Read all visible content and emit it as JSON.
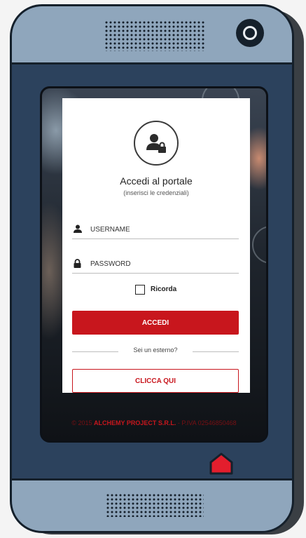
{
  "login": {
    "title": "Accedi al portale",
    "subtitle": "(inserisci le credenziali)",
    "username_placeholder": "USERNAME",
    "password_placeholder": "PASSWORD",
    "remember_label": "Ricorda",
    "submit_label": "ACCEDI",
    "divider_text": "Sei un esterno?",
    "external_label": "CLICCA QUI"
  },
  "footer": {
    "copyright": "© 2015",
    "company": "ALCHEMY PROJECT S.R.L.",
    "vat": "- P.IVA 02546850468"
  },
  "colors": {
    "accent": "#c8161d",
    "phone_body": "#2c425d",
    "phone_bars": "#8fa6bc",
    "home_button": "#e31e2d"
  },
  "icons": {
    "avatar": "user-lock-icon",
    "username": "user-icon",
    "password": "lock-icon",
    "home": "home-icon"
  }
}
